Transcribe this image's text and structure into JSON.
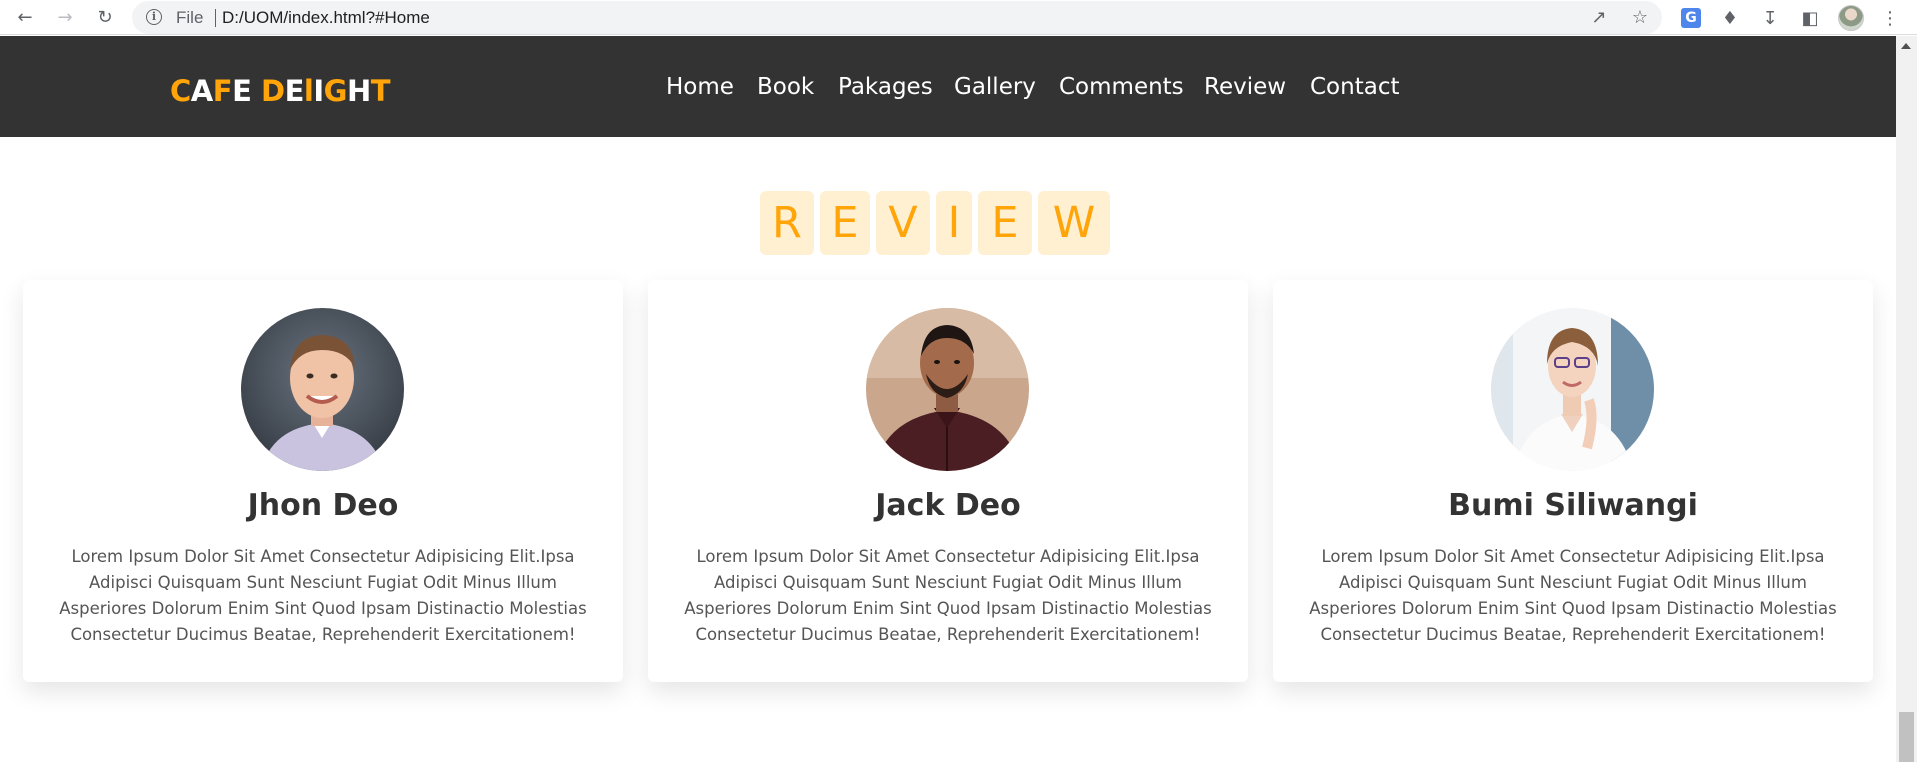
{
  "browser": {
    "scheme": "File",
    "url": "D:/UOM/index.html?#Home"
  },
  "header": {
    "logo_parts": [
      {
        "text": "C",
        "accent": true
      },
      {
        "text": "A",
        "accent": false
      },
      {
        "text": "F",
        "accent": true
      },
      {
        "text": "E",
        "accent": false
      },
      {
        "text": " ",
        "accent": false
      },
      {
        "text": "D",
        "accent": true
      },
      {
        "text": "E",
        "accent": false
      },
      {
        "text": "l",
        "accent": true
      },
      {
        "text": "I",
        "accent": false
      },
      {
        "text": "G",
        "accent": true
      },
      {
        "text": "H",
        "accent": false
      },
      {
        "text": "T",
        "accent": true
      }
    ],
    "nav": [
      {
        "label": "Home",
        "id": "home"
      },
      {
        "label": "Book",
        "id": "book"
      },
      {
        "label": "Pakages",
        "id": "pakages"
      },
      {
        "label": "Gallery",
        "id": "gallery"
      },
      {
        "label": "Comments",
        "id": "comments"
      },
      {
        "label": "Review",
        "id": "review"
      },
      {
        "label": "Contact",
        "id": "contact"
      }
    ]
  },
  "review": {
    "heading_tiles": [
      "R",
      "E",
      "V",
      "I",
      "E",
      "W"
    ]
  },
  "reviews": [
    {
      "name": "Jhon Deo",
      "text": "Lorem Ipsum Dolor Sit Amet Consectetur Adipisicing Elit.Ipsa Adipisci Quisquam Sunt Nesciunt Fugiat Odit Minus Illum Asperiores Dolorum Enim Sint Quod Ipsam Distinactio Molestias Consectetur Ducimus Beatae, Reprehenderit Exercitationem!"
    },
    {
      "name": "Jack Deo",
      "text": "Lorem Ipsum Dolor Sit Amet Consectetur Adipisicing Elit.Ipsa Adipisci Quisquam Sunt Nesciunt Fugiat Odit Minus Illum Asperiores Dolorum Enim Sint Quod Ipsam Distinactio Molestias Consectetur Ducimus Beatae, Reprehenderit Exercitationem!"
    },
    {
      "name": "Bumi Siliwangi",
      "text": "Lorem Ipsum Dolor Sit Amet Consectetur Adipisicing Elit.Ipsa Adipisci Quisquam Sunt Nesciunt Fugiat Odit Minus Illum Asperiores Dolorum Enim Sint Quod Ipsam Distinactio Molestias Consectetur Ducimus Beatae, Reprehenderit Exercitationem!"
    }
  ],
  "colors": {
    "accent": "#ffa50a",
    "header_bg": "#333333",
    "tile_bg": "#fff0d2"
  }
}
